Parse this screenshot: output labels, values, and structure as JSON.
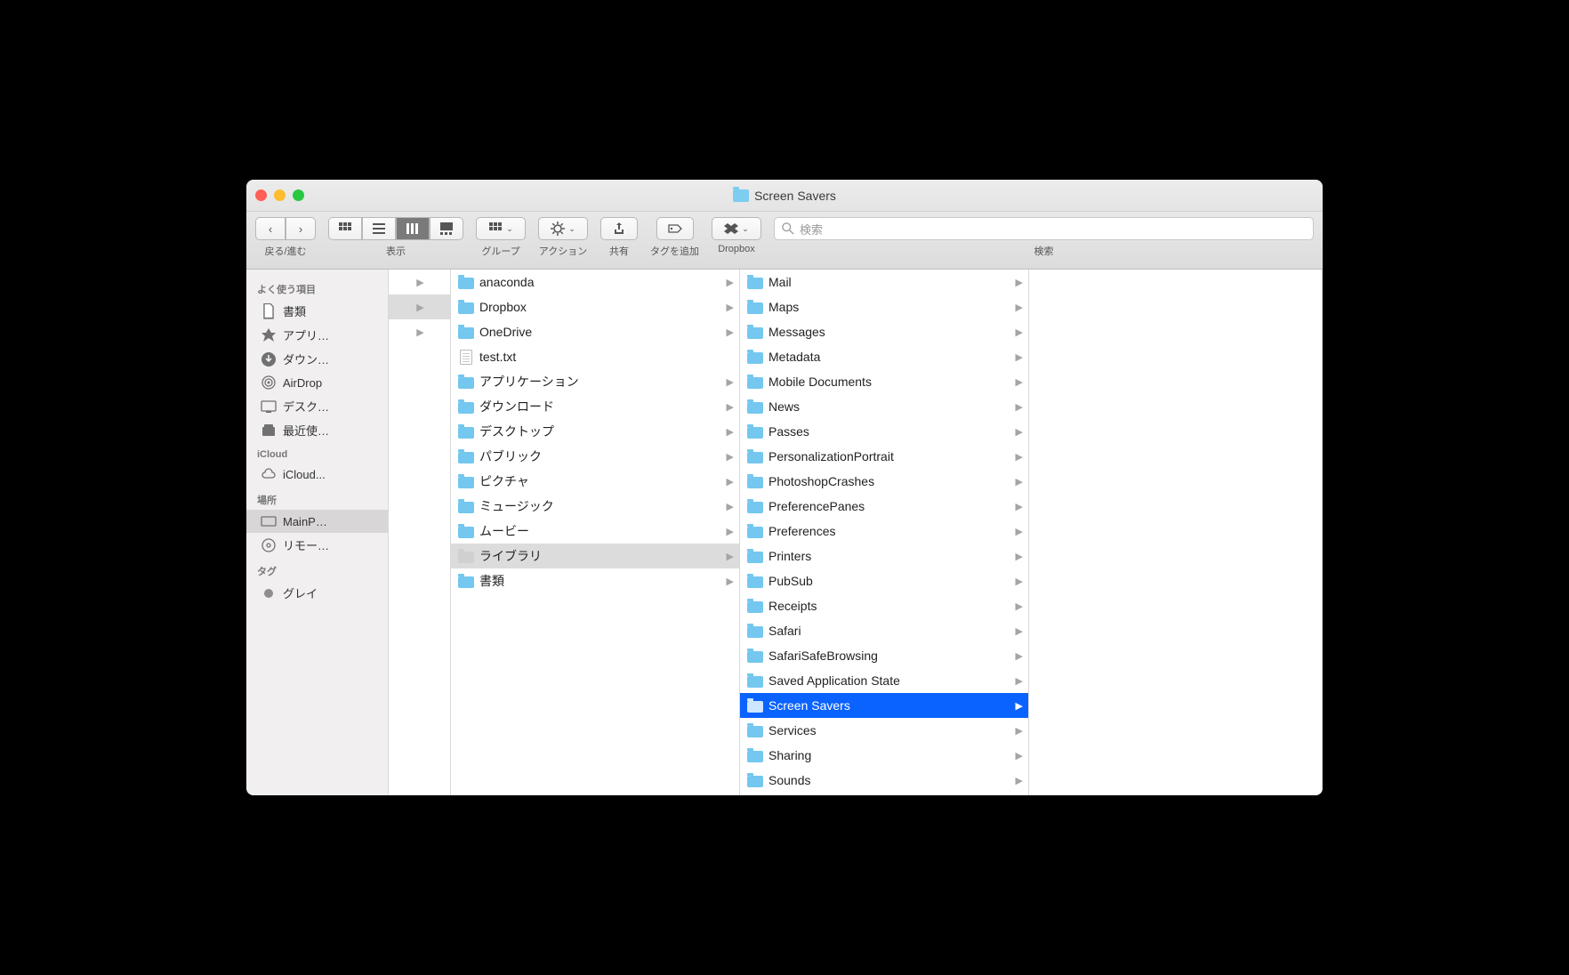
{
  "window_title": "Screen Savers",
  "toolbar": {
    "nav_label": "戻る/進む",
    "view_label": "表示",
    "group_label": "グループ",
    "action_label": "アクション",
    "share_label": "共有",
    "tags_label": "タグを追加",
    "dropbox_label": "Dropbox",
    "search_label": "検索",
    "search_placeholder": "検索"
  },
  "sidebar": {
    "favorites_header": "よく使う項目",
    "favorites": [
      "書類",
      "アプリ…",
      "ダウン…",
      "AirDrop",
      "デスク…",
      "最近使…"
    ],
    "icloud_header": "iCloud",
    "icloud": [
      "iCloud..."
    ],
    "locations_header": "場所",
    "locations": [
      "MainP…",
      "リモー…"
    ],
    "tags_header": "タグ",
    "tags": [
      "グレイ"
    ]
  },
  "col2": [
    {
      "name": "anaconda",
      "type": "folder",
      "arrow": true
    },
    {
      "name": "Dropbox",
      "type": "dropbox",
      "arrow": true
    },
    {
      "name": "OneDrive",
      "type": "cloud",
      "arrow": true
    },
    {
      "name": "test.txt",
      "type": "file",
      "arrow": false
    },
    {
      "name": "アプリケーション",
      "type": "folder",
      "arrow": true
    },
    {
      "name": "ダウンロード",
      "type": "folder",
      "arrow": true
    },
    {
      "name": "デスクトップ",
      "type": "folder",
      "arrow": true
    },
    {
      "name": "パブリック",
      "type": "folder",
      "arrow": true
    },
    {
      "name": "ピクチャ",
      "type": "folder",
      "arrow": true
    },
    {
      "name": "ミュージック",
      "type": "folder",
      "arrow": true
    },
    {
      "name": "ムービー",
      "type": "folder",
      "arrow": true
    },
    {
      "name": "ライブラリ",
      "type": "library",
      "arrow": true,
      "selected": true
    },
    {
      "name": "書類",
      "type": "folder",
      "arrow": true
    }
  ],
  "col3": [
    {
      "name": "Mail"
    },
    {
      "name": "Maps"
    },
    {
      "name": "Messages"
    },
    {
      "name": "Metadata"
    },
    {
      "name": "Mobile Documents"
    },
    {
      "name": "News"
    },
    {
      "name": "Passes"
    },
    {
      "name": "PersonalizationPortrait"
    },
    {
      "name": "PhotoshopCrashes"
    },
    {
      "name": "PreferencePanes"
    },
    {
      "name": "Preferences"
    },
    {
      "name": "Printers"
    },
    {
      "name": "PubSub"
    },
    {
      "name": "Receipts"
    },
    {
      "name": "Safari"
    },
    {
      "name": "SafariSafeBrowsing"
    },
    {
      "name": "Saved Application State"
    },
    {
      "name": "Screen Savers",
      "selected": true
    },
    {
      "name": "Services"
    },
    {
      "name": "Sharing"
    },
    {
      "name": "Sounds"
    }
  ]
}
